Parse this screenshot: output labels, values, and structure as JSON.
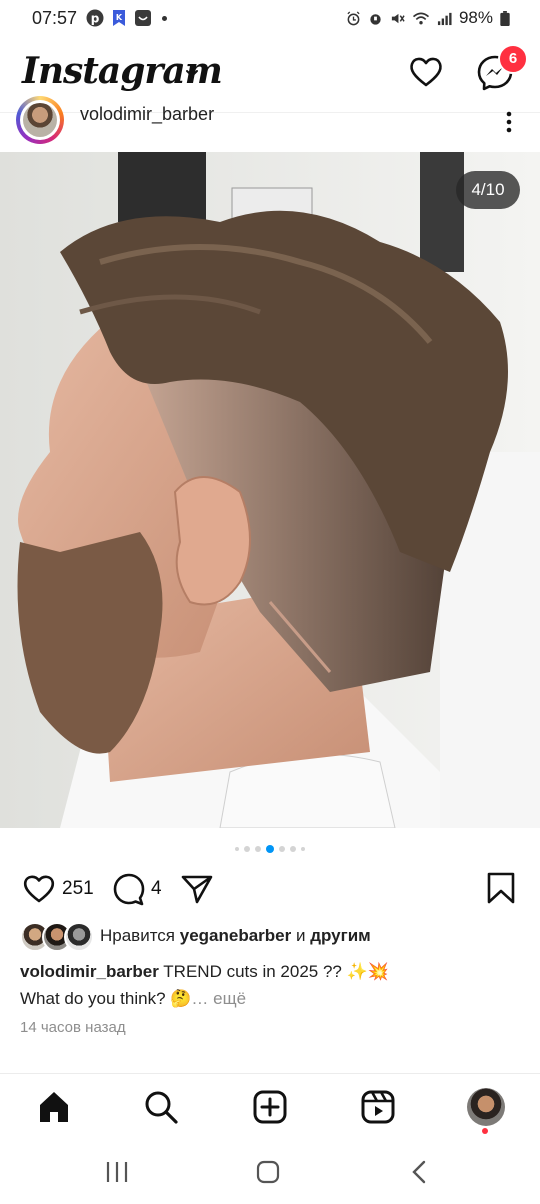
{
  "status_bar": {
    "time": "07:57",
    "battery": "98%",
    "notification_icons": [
      "pinterest-icon",
      "bookmark-app-icon",
      "smile-app-icon"
    ],
    "system_icons": [
      "alarm-icon",
      "mute-icon",
      "wifi-icon",
      "signal-icon",
      "battery-icon"
    ]
  },
  "header": {
    "logo": "Instagram",
    "messenger_badge": "6"
  },
  "post": {
    "username": "volodimir_barber",
    "carousel_counter": "4/10",
    "carousel_dots": {
      "total": 7,
      "active_index": 3
    },
    "likes_count": "251",
    "comments_count": "4",
    "likes_prefix": "Нравится",
    "liked_by_user": "yeganebarber",
    "likes_connector": "и",
    "likes_others": "другим",
    "caption_user": "volodimir_barber",
    "caption_text": "TREND cuts in 2025 ?? ✨💥",
    "caption_line2": "What do you think? 🤔",
    "caption_more": "… ещё",
    "time_ago": "14 часов назад"
  },
  "colors": {
    "accent_blue": "#0095f6",
    "badge_red": "#ff3040",
    "text_primary": "#222222",
    "text_secondary": "#8e8e8e"
  }
}
